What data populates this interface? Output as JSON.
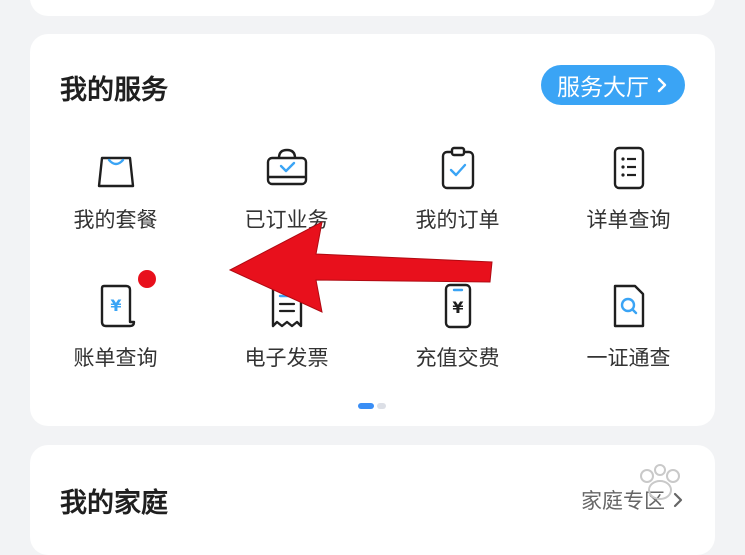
{
  "services": {
    "title": "我的服务",
    "hall_button_label": "服务大厅",
    "items": [
      {
        "label": "我的套餐",
        "icon": "shopping-bag-icon"
      },
      {
        "label": "已订业务",
        "icon": "bag-check-icon"
      },
      {
        "label": "我的订单",
        "icon": "clipboard-check-icon"
      },
      {
        "label": "详单查询",
        "icon": "list-doc-icon"
      },
      {
        "label": "账单查询",
        "icon": "bill-yen-icon"
      },
      {
        "label": "电子发票",
        "icon": "receipt-icon"
      },
      {
        "label": "充值交费",
        "icon": "phone-yen-icon"
      },
      {
        "label": "一证通查",
        "icon": "doc-search-icon"
      }
    ],
    "badge_on_item": "账单查询",
    "pager": {
      "pages": 2,
      "current": 1
    }
  },
  "family": {
    "title": "我的家庭",
    "link_label": "家庭专区"
  },
  "colors": {
    "accent": "#3aa4f5",
    "badge": "#e8101c",
    "annotation_arrow": "#e8101c"
  }
}
